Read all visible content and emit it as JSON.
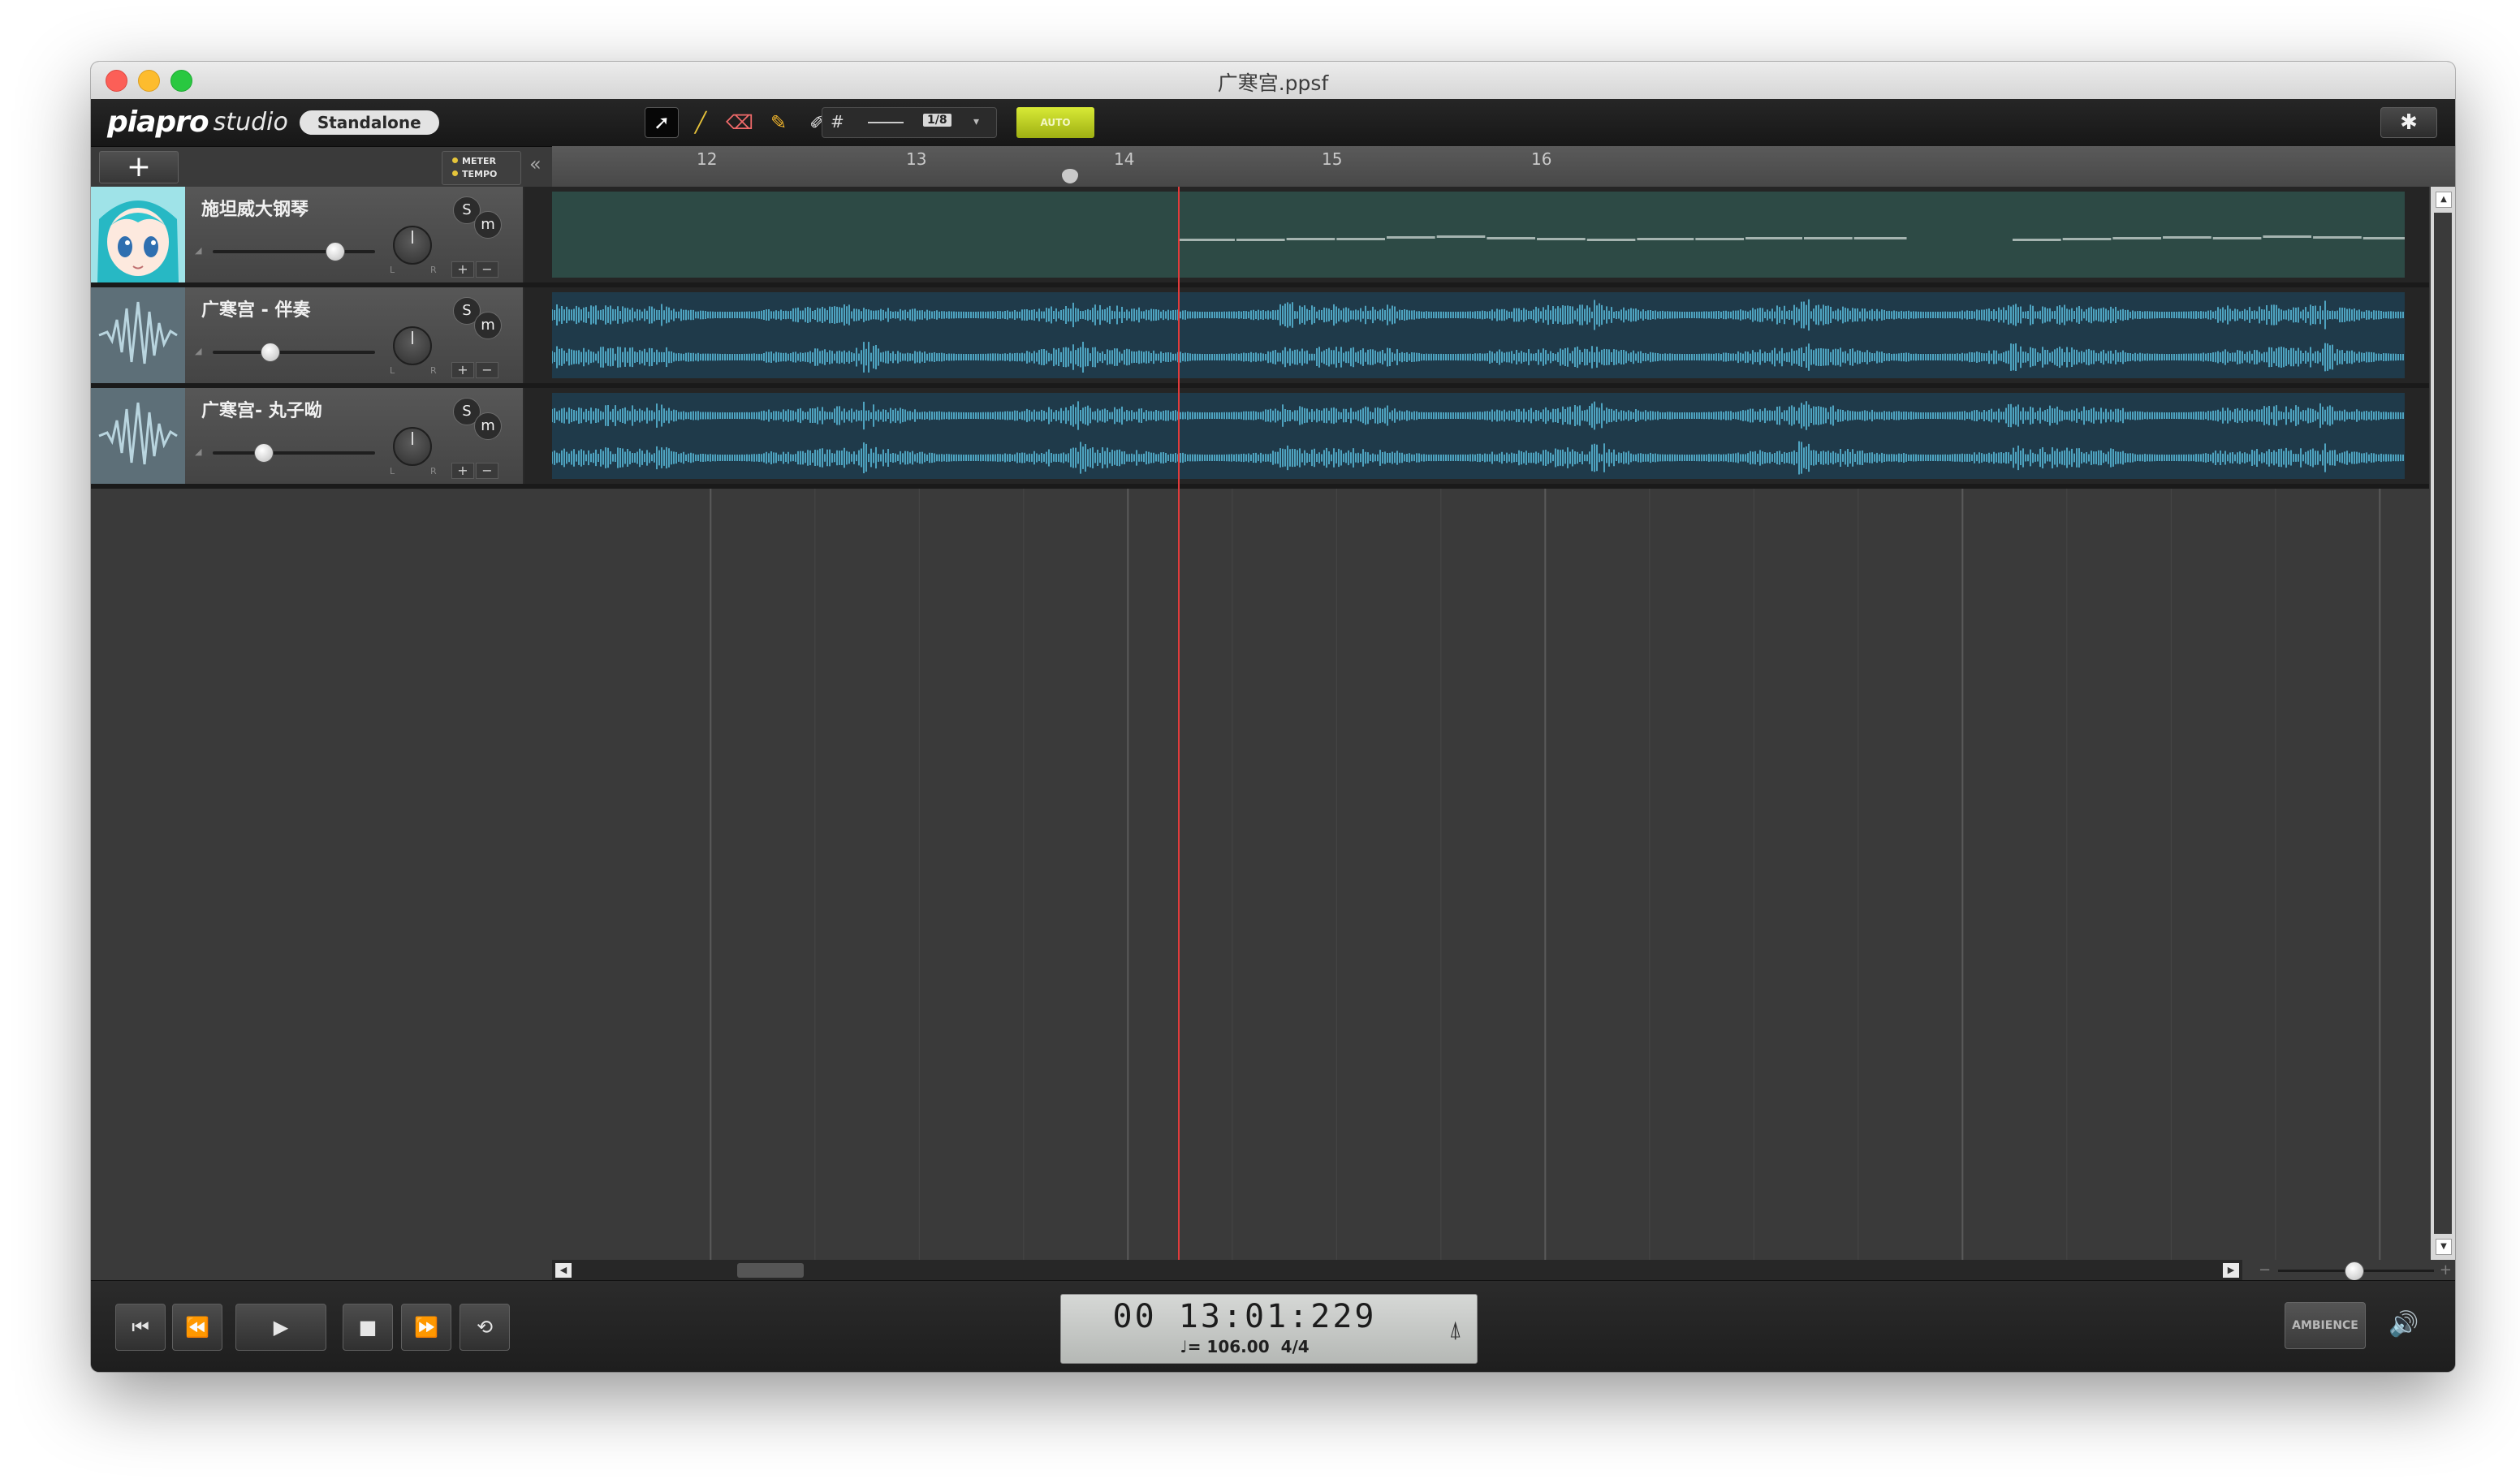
{
  "window": {
    "title": "广寒宫.ppsf"
  },
  "toolbar": {
    "brand_logo": "piapro",
    "brand_studio": "studio",
    "brand_badge": "Standalone",
    "tools": [
      {
        "name": "select-tool",
        "icon": "arrow-pointer-icon",
        "glyph": "➚"
      },
      {
        "name": "line-tool",
        "icon": "line-pen-icon",
        "glyph": "╱"
      },
      {
        "name": "eraser-tool",
        "icon": "eraser-icon",
        "glyph": "⌫"
      },
      {
        "name": "pencil-tool",
        "icon": "pencil-icon",
        "glyph": "✎"
      },
      {
        "name": "knife-tool",
        "icon": "knife-icon",
        "glyph": "✐"
      },
      {
        "name": "delete-tool",
        "icon": "x-icon",
        "glyph": "✕"
      }
    ],
    "grid_value": "1/8",
    "auto_label": "AUTO",
    "settings_glyph": "✱"
  },
  "header": {
    "add_glyph": "+",
    "meter_label": "METER",
    "tempo_label": "TEMPO",
    "collapse_glyph": "«"
  },
  "ruler": {
    "bars": [
      "12",
      "13",
      "14",
      "15",
      "16"
    ]
  },
  "tracks": [
    {
      "name": "施坦威大钢琴",
      "type": "midi",
      "volume": 0.75,
      "solo": "S",
      "mute": "m"
    },
    {
      "name": "广寒宫 - 伴奏",
      "type": "audio",
      "volume": 0.35,
      "solo": "S",
      "mute": "m"
    },
    {
      "name": "广寒宫- 丸子呦",
      "type": "audio",
      "volume": 0.31,
      "solo": "S",
      "mute": "m"
    }
  ],
  "track_controls": {
    "plus": "+",
    "minus": "−",
    "left": "L",
    "right": "R"
  },
  "transport": {
    "rewind_start": "⏮",
    "rewind": "⏪",
    "play": "▶",
    "stop": "■",
    "fast_forward": "⏩",
    "loop": "⟲",
    "time": "00 13:01:229",
    "tempo": "♩= 106.00",
    "meter": "4/4",
    "metronome_glyph": "⍋",
    "ambience_label": "AMBIENCE",
    "speaker_glyph": "🔊"
  },
  "colors": {
    "midi_clip": "#2d4a45",
    "audio_clip": "#1f3a4a",
    "waveform": "#4ea3c0",
    "playhead": "#e23b3b",
    "auto_button": "#c7d928"
  },
  "playhead_position_bar": 13.12
}
